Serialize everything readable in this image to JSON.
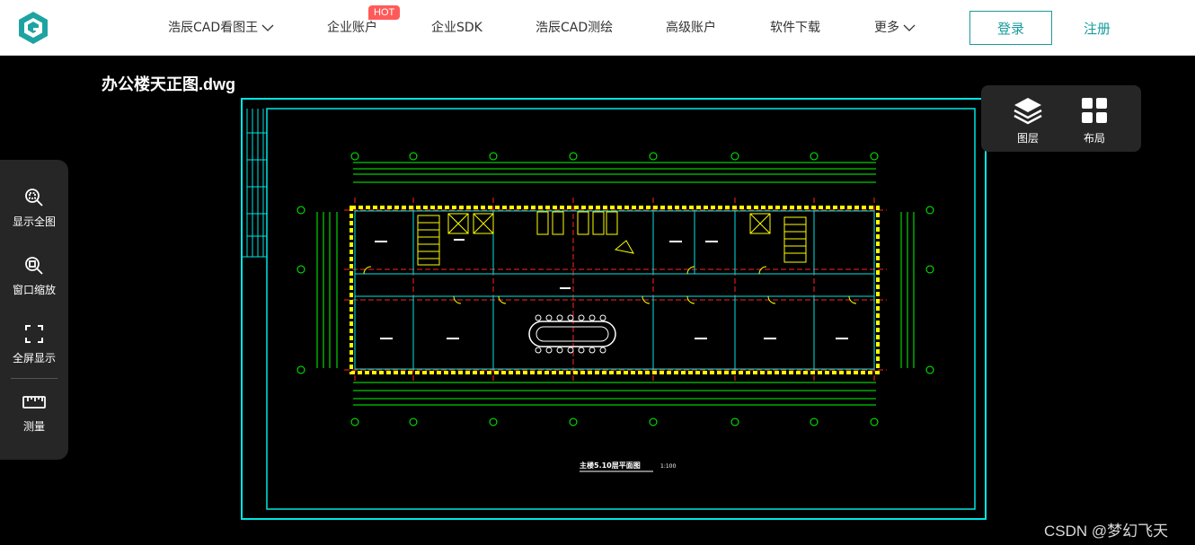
{
  "header": {
    "nav": [
      {
        "label": "浩辰CAD看图王",
        "has_dropdown": true
      },
      {
        "label": "企业账户",
        "badge": "HOT"
      },
      {
        "label": "企业SDK"
      },
      {
        "label": "浩辰CAD测绘"
      },
      {
        "label": "高级账户"
      },
      {
        "label": "软件下载"
      },
      {
        "label": "更多",
        "has_dropdown": true
      }
    ],
    "login_label": "登录",
    "register_label": "注册"
  },
  "file_title": "办公楼天正图.dwg",
  "left_toolbar": {
    "items": [
      {
        "label": "显示全图",
        "icon": "zoom-extents-icon"
      },
      {
        "label": "窗口缩放",
        "icon": "zoom-window-icon"
      },
      {
        "label": "全屏显示",
        "icon": "fullscreen-icon"
      },
      {
        "label": "测量",
        "icon": "ruler-icon"
      }
    ]
  },
  "right_panel": {
    "items": [
      {
        "label": "图层",
        "icon": "layers-icon"
      },
      {
        "label": "布局",
        "icon": "layout-icon"
      }
    ]
  },
  "drawing": {
    "title": "主楼5.10层平面图",
    "scale": "1:100"
  },
  "watermark": "CSDN @梦幻飞天",
  "colors": {
    "accent": "#1a9c9c",
    "hot_badge": "#ff5a5a",
    "cad_background": "#000000",
    "cad_frame": "#00e5e5",
    "cad_dims": "#00ff00",
    "cad_walls": "#ffff00",
    "cad_axes": "#ff2020"
  }
}
